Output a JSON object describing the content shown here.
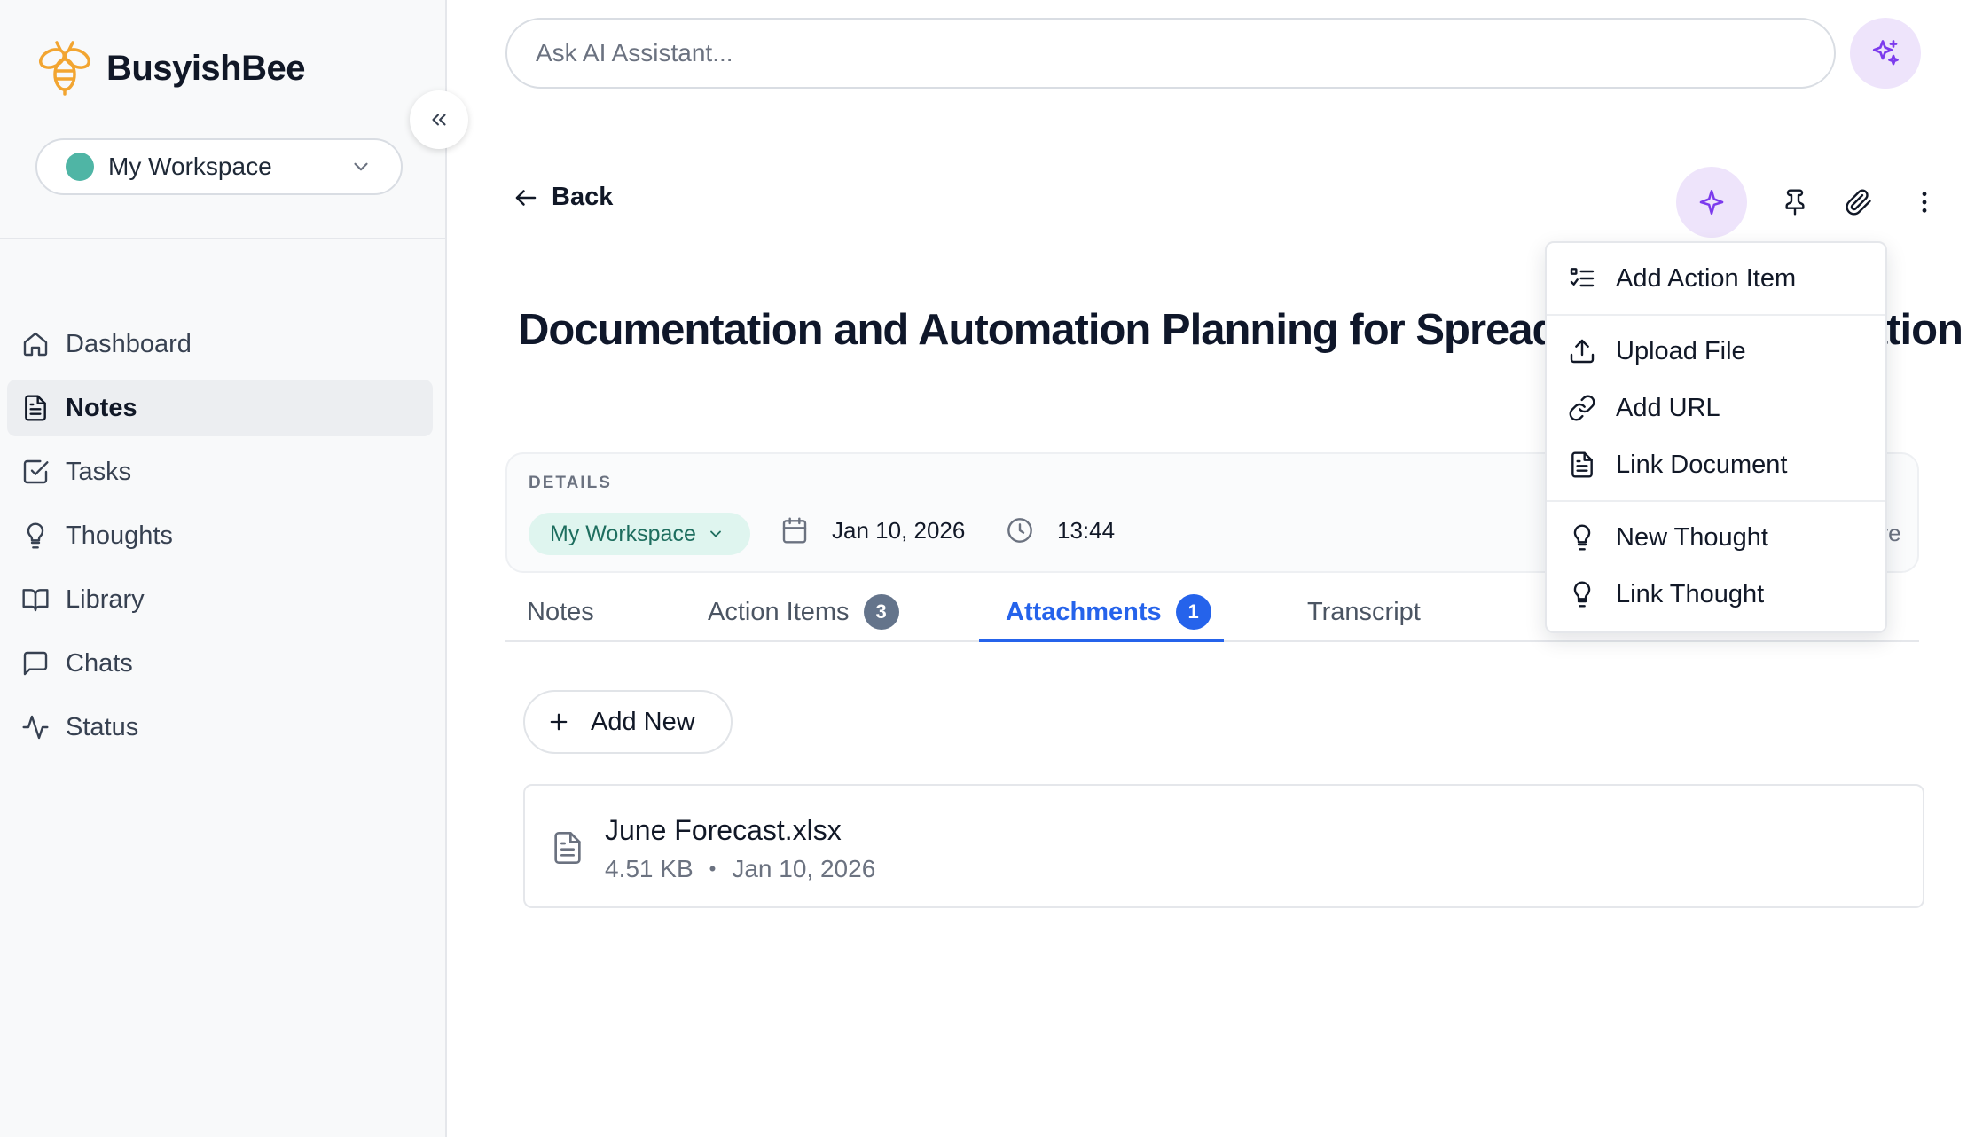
{
  "brand": {
    "name": "BusyishBee"
  },
  "workspace": {
    "name": "My Workspace"
  },
  "sidebar": {
    "items": [
      {
        "label": "Dashboard",
        "icon": "home-icon",
        "active": false
      },
      {
        "label": "Notes",
        "icon": "file-text-icon",
        "active": true
      },
      {
        "label": "Tasks",
        "icon": "check-square-icon",
        "active": false
      },
      {
        "label": "Thoughts",
        "icon": "lightbulb-icon",
        "active": false
      },
      {
        "label": "Library",
        "icon": "book-open-icon",
        "active": false
      },
      {
        "label": "Chats",
        "icon": "message-square-icon",
        "active": false
      },
      {
        "label": "Status",
        "icon": "activity-icon",
        "active": false
      }
    ]
  },
  "ai": {
    "placeholder": "Ask AI Assistant..."
  },
  "header": {
    "back_label": "Back"
  },
  "note": {
    "title": "Documentation and Automation Planning for Spreadsheet Reconciliation",
    "details_label": "DETAILS",
    "workspace_chip": "My Workspace",
    "date": "Jan 10, 2026",
    "time": "13:44",
    "more_label": "ore"
  },
  "tabs": [
    {
      "label": "Notes",
      "count": null,
      "active": false
    },
    {
      "label": "Action Items",
      "count": "3",
      "active": false
    },
    {
      "label": "Attachments",
      "count": "1",
      "active": true
    },
    {
      "label": "Transcript",
      "count": null,
      "active": false
    }
  ],
  "add_new_label": "Add New",
  "attachments": [
    {
      "name": "June Forecast.xlsx",
      "size": "4.51 KB",
      "date": "Jan 10, 2026"
    }
  ],
  "dropdown": {
    "items": [
      {
        "label": "Add Action Item",
        "icon": "list-checks-icon"
      },
      {
        "label": "Upload File",
        "icon": "upload-icon"
      },
      {
        "label": "Add URL",
        "icon": "link-icon"
      },
      {
        "label": "Link Document",
        "icon": "file-text-icon"
      },
      {
        "label": "New Thought",
        "icon": "lightbulb-icon"
      },
      {
        "label": "Link Thought",
        "icon": "lightbulb-icon"
      }
    ]
  },
  "colors": {
    "accent": "#2563eb",
    "ai_purple": "#7c3aed",
    "ai_bg": "#eee4fb",
    "workspace_dot": "#4fb5a5",
    "brand_orange": "#f2a531"
  }
}
